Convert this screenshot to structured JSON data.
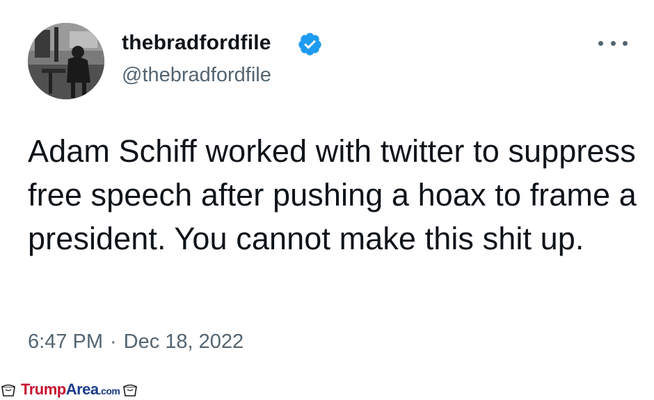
{
  "tweet": {
    "display_name": "thebradfordfile",
    "handle": "@thebradfordfile",
    "verified": true,
    "text": "Adam Schiff worked with twitter to suppress free speech after pushing a hoax to frame a president. You cannot make this shit up.",
    "time": "6:47 PM",
    "separator": "·",
    "date": "Dec 18, 2022"
  },
  "icons": {
    "verified": "verified-badge-icon",
    "more": "more-options-icon",
    "watermark": "cup-icon"
  },
  "colors": {
    "verified_blue": "#1d9bf0",
    "secondary_text": "#536471",
    "primary_text": "#0f1419",
    "watermark_red": "#c8102e",
    "watermark_blue": "#1a3a8c"
  },
  "watermark": {
    "part1": "Trump",
    "part2": "Area",
    "part3": ".com"
  }
}
